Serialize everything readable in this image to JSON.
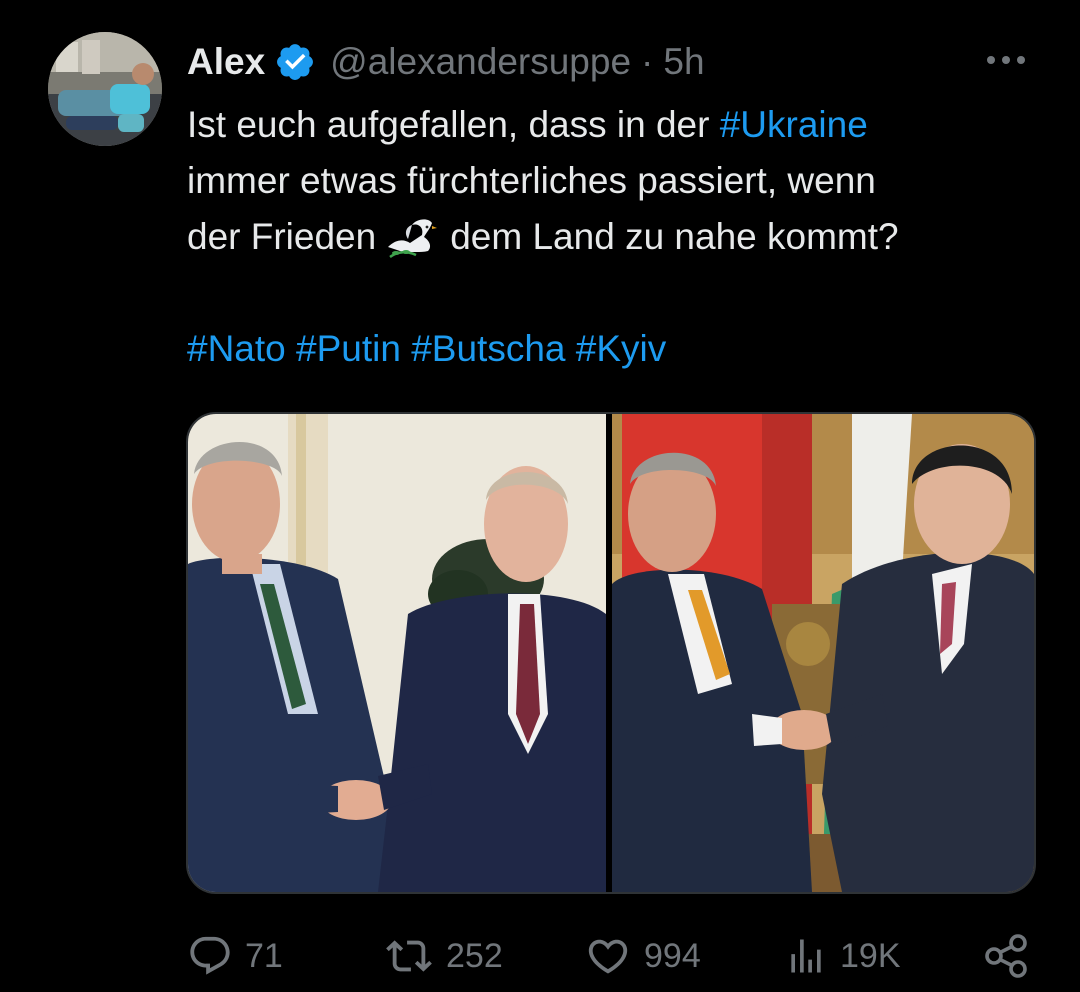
{
  "author": {
    "name": "Alex",
    "handle": "@alexandersuppe",
    "separator": "·",
    "time": "5h"
  },
  "tweet": {
    "line1": {
      "text": "Ist euch aufgefallen, dass in der ",
      "hashtag": "#Ukraine"
    },
    "line2": "immer etwas fürchterliches passiert, wenn",
    "line3": {
      "before": "der Frieden",
      "after": "dem Land zu nahe kommt?"
    },
    "hashtags": [
      "#Nato",
      "#Putin",
      "#Butscha",
      "#Kyiv"
    ]
  },
  "media": {
    "count": 2,
    "left_image": "handshake-photo-1",
    "right_image": "handshake-photo-2"
  },
  "actions": {
    "replies": "71",
    "reposts": "252",
    "likes": "994",
    "views": "19K"
  },
  "icons": {
    "verified": "verified-badge-icon",
    "more": "more-options-icon",
    "emoji": "dove-emoji-icon",
    "reply": "reply-icon",
    "repost": "repost-icon",
    "like": "like-icon",
    "views": "views-icon",
    "share": "share-icon"
  },
  "colors": {
    "background": "#000000",
    "text": "#e7e9ea",
    "secondary": "#71767b",
    "link": "#1d9bf0",
    "border": "#2f3336"
  }
}
